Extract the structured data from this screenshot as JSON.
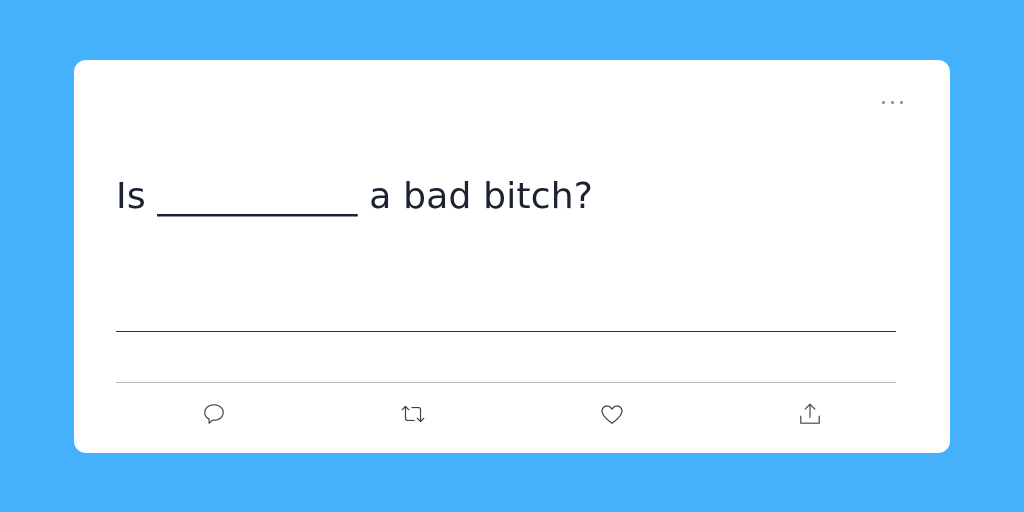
{
  "tweet": {
    "text": "Is ___________ a bad bitch?"
  },
  "colors": {
    "background": "#45b0fc",
    "card": "#ffffff",
    "text": "#1b2230",
    "icon": "#394150"
  },
  "actions": [
    {
      "name": "reply",
      "icon": "speech-bubble-icon"
    },
    {
      "name": "retweet",
      "icon": "retweet-arrows-icon"
    },
    {
      "name": "like",
      "icon": "heart-icon"
    },
    {
      "name": "share",
      "icon": "share-upload-icon"
    }
  ]
}
